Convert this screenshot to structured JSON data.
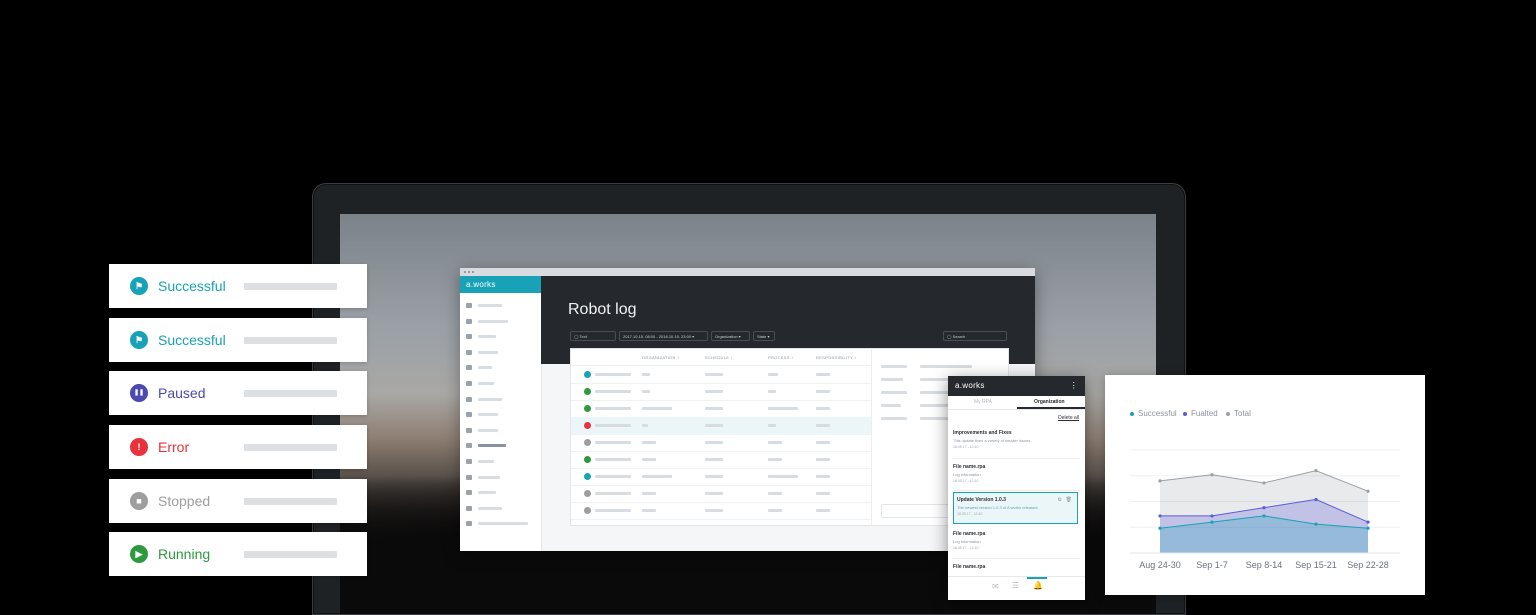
{
  "status_cards": [
    {
      "label": "Successful",
      "color": "#17a2b8",
      "icon": "flag-icon"
    },
    {
      "label": "Successful",
      "color": "#17a2b8",
      "icon": "flag-icon"
    },
    {
      "label": "Paused",
      "color": "#4a4ab0",
      "icon": "pause-icon"
    },
    {
      "label": "Error",
      "color": "#e8323c",
      "icon": "exclamation-icon"
    },
    {
      "label": "Stopped",
      "color": "#9e9e9e",
      "icon": "stop-icon"
    },
    {
      "label": "Running",
      "color": "#2e9a3e",
      "icon": "play-icon"
    }
  ],
  "desktop_app": {
    "logo": "a.works",
    "title": "Robot log",
    "filters": {
      "text": "Text",
      "date_range": "2017.10.15. 08:00 - 2018.10.15. 23:00",
      "organization": "Organization",
      "state": "State",
      "search_placeholder": "Search"
    },
    "columns": [
      "ORGANIZATION",
      "SCHEDULE",
      "PROCESS",
      "RESPONSIBILITY"
    ],
    "row_statuses": [
      "successful",
      "running",
      "running",
      "error",
      "stopped",
      "running",
      "successful",
      "stopped",
      "stopped"
    ]
  },
  "mobile_app": {
    "logo": "a.works",
    "tabs": [
      "My RPA",
      "Organization"
    ],
    "active_tab": "Organization",
    "delete_all": "Delete all",
    "items": [
      {
        "title": "Improvements and Fixes",
        "subtitle": "This update fixes a variety of smaller issues.",
        "date": "18.05.17 - 12:10"
      },
      {
        "title": "File name.rpa",
        "subtitle": "Log information",
        "date": "18.05.17 - 12:10"
      },
      {
        "title": "Update Version 1.0.3",
        "subtitle": "The newest version 1.0.3 of A works released.",
        "date": "18.05.17 - 12:10"
      },
      {
        "title": "File name.rpa",
        "subtitle": "Log information",
        "date": "18.05.17 - 12:10"
      },
      {
        "title": "File name.rpa",
        "subtitle": "",
        "date": ""
      }
    ]
  },
  "chart_data": {
    "type": "area",
    "categories": [
      "Aug 24-30",
      "Sep 1-7",
      "Sep 8-14",
      "Sep 15-21",
      "Sep 22-28"
    ],
    "series": [
      {
        "name": "Successful",
        "color": "#17a2b8",
        "values": [
          12,
          15,
          18,
          14,
          12
        ]
      },
      {
        "name": "Fualted",
        "color": "#5b5bd6",
        "values": [
          18,
          18,
          22,
          26,
          15
        ]
      },
      {
        "name": "Total",
        "color": "#9aa0a6",
        "values": [
          35,
          38,
          34,
          40,
          30
        ]
      }
    ],
    "ylim": [
      0,
      50
    ],
    "grid": true,
    "legend": "top-left"
  }
}
